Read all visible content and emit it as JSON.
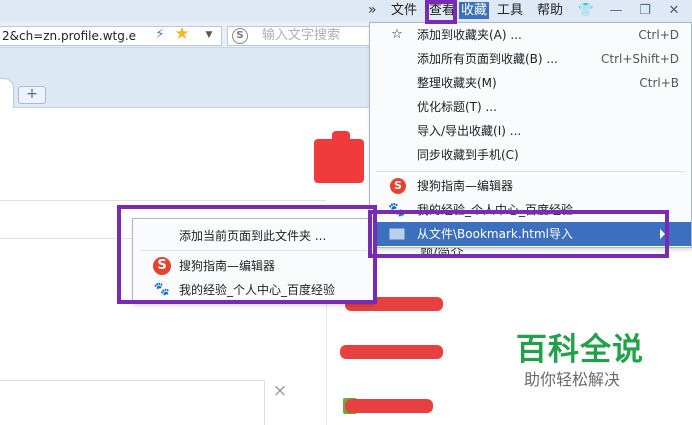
{
  "address": {
    "url": "2&ch=zn.profile.wtg.e",
    "bolt_icon": "bolt-icon",
    "star_icon": "star-icon"
  },
  "search": {
    "placeholder": "输入文字搜索",
    "engine_icon": "S"
  },
  "tabs": {
    "new_tab_label": "+"
  },
  "menubar": {
    "overflow": "»",
    "items": [
      {
        "label": "文件"
      },
      {
        "label": "查看"
      },
      {
        "label": "收藏"
      },
      {
        "label": "工具"
      },
      {
        "label": "帮助"
      }
    ],
    "active": "收藏",
    "icons": [
      "shirt-icon",
      "minimize-icon",
      "restore-icon",
      "close-icon"
    ]
  },
  "favorites_menu": {
    "items": [
      {
        "label": "添加到收藏夹(A) ...",
        "shortcut": "Ctrl+D",
        "icon": "☆"
      },
      {
        "label": "添加所有页面到收藏(B) ...",
        "shortcut": "Ctrl+Shift+D"
      },
      {
        "label": "整理收藏夹(M)",
        "shortcut": "Ctrl+B"
      },
      {
        "label": "优化标题(T) ..."
      },
      {
        "label": "导入/导出收藏(I) ..."
      },
      {
        "label": "同步收藏到手机(C)"
      },
      {
        "label": "搜狗指南—编辑器",
        "icon": "S"
      },
      {
        "label": "我的经验_个人中心_百度经验",
        "icon": "🐾"
      },
      {
        "label": "从文件\\Bookmark.html导入"
      }
    ]
  },
  "submenu": {
    "items": [
      {
        "label": "添加当前页面到此文件夹 ..."
      },
      {
        "label": "搜狗指南—编辑器",
        "icon": "S"
      },
      {
        "label": "我的经验_个人中心_百度经验",
        "icon": "🐾"
      }
    ]
  },
  "page": {
    "side_fragment": "题/简介",
    "close_glyph": "×"
  },
  "watermark": {
    "title": "百科全说",
    "subtitle": "助你轻松解决"
  },
  "colors": {
    "annotation": "#7a2bb5",
    "highlight": "#3c6fbd",
    "watermark": "#21a14a",
    "redact": "#e84040"
  }
}
